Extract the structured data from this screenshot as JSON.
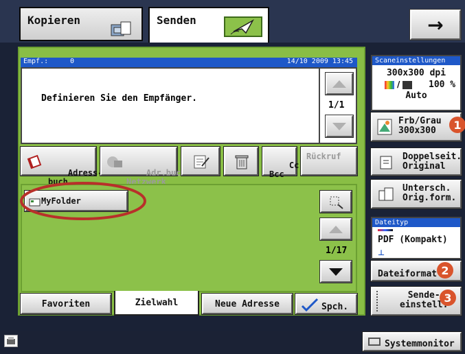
{
  "tabs": [
    {
      "label": "Kopieren",
      "active": false
    },
    {
      "label": "Senden",
      "active": true
    }
  ],
  "top_right_arrow": "→",
  "recipient": {
    "empf_label": "Empf.:",
    "empf_count": "0",
    "datetime": "14/10 2009 13:45",
    "message": "Definieren Sie den Empfänger.",
    "page": "1/1"
  },
  "toolbar": {
    "address_book": "Adress-\nbuch",
    "network_book": "Adr.buch\nNetzwerk",
    "cc_bcc": "Cc\nBcc",
    "recall": "Rückruf"
  },
  "list": {
    "item": "MyFolder",
    "page": "1/17"
  },
  "bottom_tabs": {
    "favorites": "Favoriten",
    "zielwahl": "Zielwahl",
    "new_address": "Neue Adresse",
    "store": "Spch."
  },
  "scan_settings": {
    "header": "Scaneinstellungen",
    "resolution": "300x300 dpi",
    "zoom": "100 %",
    "mode": "Auto",
    "color_btn_line1": "Frb/Grau",
    "color_btn_line2": "300x300"
  },
  "duplex": {
    "line1": "Doppelseit.",
    "line2": "Original"
  },
  "mixed": {
    "line1": "Untersch.",
    "line2": "Orig.form."
  },
  "file_type": {
    "header": "Dateityp",
    "value": "PDF (Kompakt)",
    "button": "Dateiformat"
  },
  "send_settings": {
    "line1": "Sende-",
    "line2": "einstell."
  },
  "markers": {
    "one": "1",
    "two": "2",
    "three": "3"
  },
  "status": {
    "system_monitor": "Systemmonitor"
  },
  "colors": {
    "accent_green": "#89be45",
    "accent_blue": "#1e58c8",
    "highlight_red": "#d9542c"
  }
}
